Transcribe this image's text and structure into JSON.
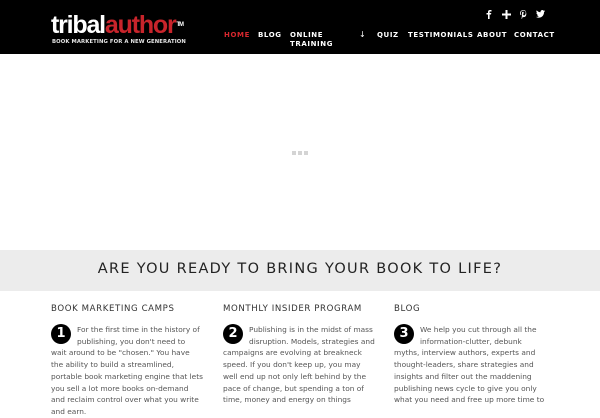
{
  "header": {
    "logo": {
      "part1": "tribal",
      "part2": "author",
      "tm": "TM",
      "tagline": "BOOK MARKETING FOR A NEW GENERATION"
    },
    "social": [
      "facebook-icon",
      "google-plus-icon",
      "pinterest-icon",
      "twitter-icon"
    ],
    "nav": [
      {
        "label": "HOME",
        "active": true
      },
      {
        "label": "BLOG"
      },
      {
        "label": "ONLINE\nTRAINING",
        "has_dropdown": true
      },
      {
        "label": "QUIZ"
      },
      {
        "label": "TESTIMONIALS"
      },
      {
        "label": "ABOUT"
      },
      {
        "label": "CONTACT"
      }
    ],
    "dropdown_arrow": "↓"
  },
  "banner": {
    "title": "ARE YOU READY TO BRING YOUR BOOK TO LIFE?"
  },
  "columns": [
    {
      "number": "1",
      "title": "BOOK MARKETING CAMPS",
      "body": "For the first time in the history of publishing, you don't need to wait around to be \"chosen.\" You have the ability to build a streamlined, portable book marketing engine that lets you sell a lot more books on-demand and reclaim control over what you write and earn."
    },
    {
      "number": "2",
      "title": "MONTHLY INSIDER PROGRAM",
      "body": "Publishing is in the midst of mass disruption. Models, strategies and campaigns are evolving at breakneck speed. If you don't keep up, you may well end up not only left behind by the pace of change, but spending a ton of time, money and energy on things"
    },
    {
      "number": "3",
      "title": "BLOG",
      "body": "We help you cut through all the information-clutter, debunk myths, interview authors, experts and thought-leaders, share strategies and insights and filter out the maddening publishing news cycle to give you only what you need and free up more time to"
    }
  ],
  "colors": {
    "accent": "#d6272e",
    "header_bg": "#000000",
    "banner_bg": "#ececec"
  }
}
